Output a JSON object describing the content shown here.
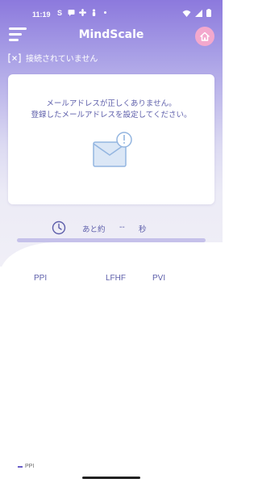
{
  "status_bar": {
    "time": "11:19",
    "left_icons": [
      "s-icon",
      "message-icon",
      "fan-icon",
      "person-icon",
      "dot-icon"
    ],
    "right_icons": [
      "wifi-icon",
      "signal-icon",
      "battery-icon"
    ]
  },
  "header": {
    "title": "MindScale"
  },
  "connection": {
    "status_text": "接続されていません"
  },
  "card": {
    "message_line1": "メールアドレスが正しくありません。",
    "message_line2": "登録したメールアドレスを設定してください。"
  },
  "timer": {
    "prefix": "あと約",
    "value": "--",
    "unit": "秒"
  },
  "progress": {
    "value": 0
  },
  "metrics": {
    "labels": [
      "PPI",
      "LFHF",
      "PVI"
    ]
  },
  "legend": {
    "label": "PPI"
  },
  "colors": {
    "accent": "#5d5eaa",
    "header_gradient_top": "#8c79dd",
    "home_button": "#f3a8cd"
  }
}
